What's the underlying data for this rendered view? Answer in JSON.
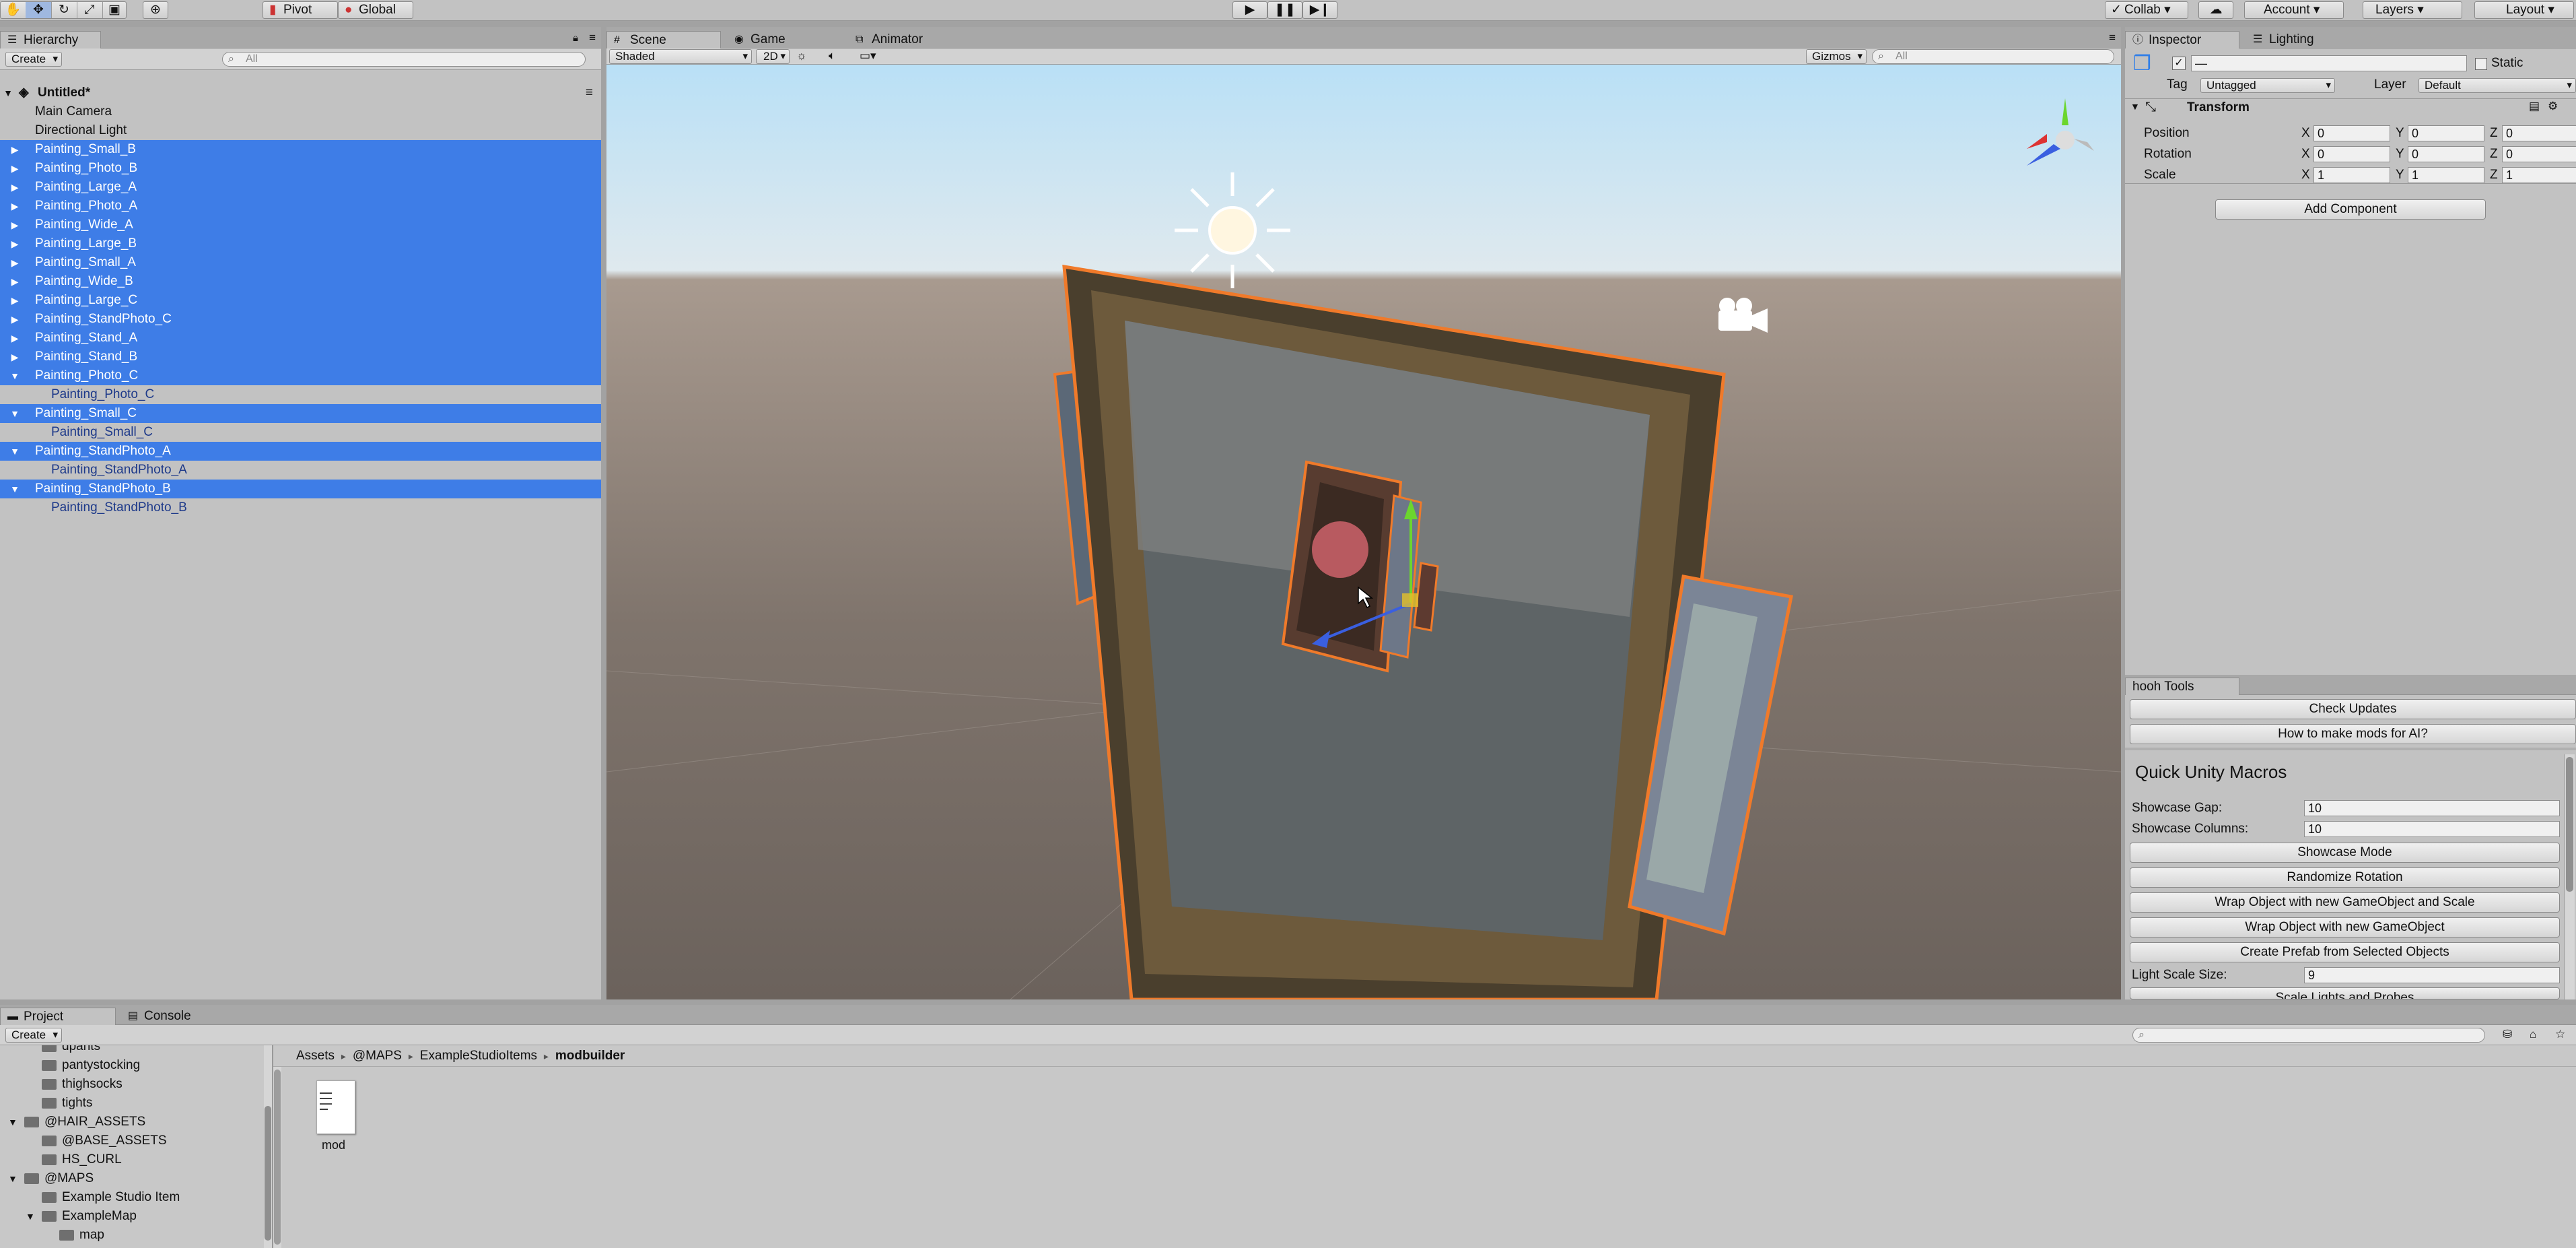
{
  "toolbar": {
    "pivot": "Pivot",
    "global": "Global",
    "collab": "Collab",
    "account": "Account",
    "layers": "Layers",
    "layout": "Layout"
  },
  "hierarchy": {
    "tab": "Hierarchy",
    "create": "Create",
    "search_placeholder": "All",
    "scene_name": "Untitled*",
    "rows": [
      {
        "label": "Main Camera",
        "selected": false,
        "indent": 1,
        "arrow": ""
      },
      {
        "label": "Directional Light",
        "selected": false,
        "indent": 1,
        "arrow": ""
      },
      {
        "label": "Painting_Small_B",
        "selected": true,
        "indent": 1,
        "arrow": "right"
      },
      {
        "label": "Painting_Photo_B",
        "selected": true,
        "indent": 1,
        "arrow": "right"
      },
      {
        "label": "Painting_Large_A",
        "selected": true,
        "indent": 1,
        "arrow": "right"
      },
      {
        "label": "Painting_Photo_A",
        "selected": true,
        "indent": 1,
        "arrow": "right"
      },
      {
        "label": "Painting_Wide_A",
        "selected": true,
        "indent": 1,
        "arrow": "right"
      },
      {
        "label": "Painting_Large_B",
        "selected": true,
        "indent": 1,
        "arrow": "right"
      },
      {
        "label": "Painting_Small_A",
        "selected": true,
        "indent": 1,
        "arrow": "right"
      },
      {
        "label": "Painting_Wide_B",
        "selected": true,
        "indent": 1,
        "arrow": "right"
      },
      {
        "label": "Painting_Large_C",
        "selected": true,
        "indent": 1,
        "arrow": "right"
      },
      {
        "label": "Painting_StandPhoto_C",
        "selected": true,
        "indent": 1,
        "arrow": "right"
      },
      {
        "label": "Painting_Stand_A",
        "selected": true,
        "indent": 1,
        "arrow": "right"
      },
      {
        "label": "Painting_Stand_B",
        "selected": true,
        "indent": 1,
        "arrow": "right"
      },
      {
        "label": "Painting_Photo_C",
        "selected": true,
        "indent": 1,
        "arrow": "down"
      },
      {
        "label": "Painting_Photo_C",
        "selected": false,
        "indent": 2,
        "arrow": "",
        "child": true
      },
      {
        "label": "Painting_Small_C",
        "selected": true,
        "indent": 1,
        "arrow": "down"
      },
      {
        "label": "Painting_Small_C",
        "selected": false,
        "indent": 2,
        "arrow": "",
        "child": true
      },
      {
        "label": "Painting_StandPhoto_A",
        "selected": true,
        "indent": 1,
        "arrow": "down"
      },
      {
        "label": "Painting_StandPhoto_A",
        "selected": false,
        "indent": 2,
        "arrow": "",
        "child": true
      },
      {
        "label": "Painting_StandPhoto_B",
        "selected": true,
        "indent": 1,
        "arrow": "down"
      },
      {
        "label": "Painting_StandPhoto_B",
        "selected": false,
        "indent": 2,
        "arrow": "",
        "child": true
      }
    ]
  },
  "scene": {
    "tabs": {
      "scene": "Scene",
      "game": "Game",
      "animator": "Animator"
    },
    "shading": "Shaded",
    "mode_2d": "2D",
    "gizmos": "Gizmos",
    "search_placeholder": "All"
  },
  "inspector": {
    "tabs": {
      "inspector": "Inspector",
      "lighting": "Lighting"
    },
    "object_name": "—",
    "static_label": "Static",
    "tag_label": "Tag",
    "tag_value": "Untagged",
    "layer_label": "Layer",
    "layer_value": "Default",
    "component": "Transform",
    "axis_x": "X",
    "axis_y": "Y",
    "axis_z": "Z",
    "position_label": "Position",
    "position": [
      "0",
      "0",
      "0"
    ],
    "rotation_label": "Rotation",
    "rotation": [
      "0",
      "0",
      "0"
    ],
    "scale_label": "Scale",
    "scale": [
      "1",
      "1",
      "1"
    ],
    "add_component": "Add Component"
  },
  "hooh": {
    "tab": "hooh Tools",
    "check_updates": "Check Updates",
    "how_to": "How to make mods for AI?",
    "macros_title": "Quick Unity Macros",
    "showcase_gap_label": "Showcase Gap:",
    "showcase_gap": "10",
    "showcase_columns_label": "Showcase Columns:",
    "showcase_columns": "10",
    "showcase_mode": "Showcase Mode",
    "randomize_rotation": "Randomize Rotation",
    "wrap_scale": "Wrap Object with new GameObject and Scale",
    "wrap": "Wrap Object with new GameObject",
    "create_prefab": "Create Prefab from Selected Objects",
    "light_scale_label": "Light Scale Size:",
    "light_scale": "9",
    "scale_lights": "Scale Lights and Probes"
  },
  "project": {
    "tabs": {
      "project": "Project",
      "console": "Console"
    },
    "create": "Create",
    "breadcrumb": [
      "Assets",
      "@MAPS",
      "ExampleStudioItems",
      "modbuilder"
    ],
    "tree": [
      {
        "label": "dpants",
        "indent": 2,
        "arrow": ""
      },
      {
        "label": "pantystocking",
        "indent": 2,
        "arrow": ""
      },
      {
        "label": "thighsocks",
        "indent": 2,
        "arrow": ""
      },
      {
        "label": "tights",
        "indent": 2,
        "arrow": ""
      },
      {
        "label": "@HAIR_ASSETS",
        "indent": 1,
        "arrow": "down"
      },
      {
        "label": "@BASE_ASSETS",
        "indent": 2,
        "arrow": ""
      },
      {
        "label": "HS_CURL",
        "indent": 2,
        "arrow": ""
      },
      {
        "label": "@MAPS",
        "indent": 1,
        "arrow": "down"
      },
      {
        "label": "Example Studio Item",
        "indent": 2,
        "arrow": ""
      },
      {
        "label": "ExampleMap",
        "indent": 2,
        "arrow": "down"
      },
      {
        "label": "map",
        "indent": 3,
        "arrow": ""
      }
    ],
    "asset_name": "mod"
  },
  "colors": {
    "selection": "#3e7de7",
    "outline": "#f07a2a",
    "panel": "#c2c2c2"
  }
}
